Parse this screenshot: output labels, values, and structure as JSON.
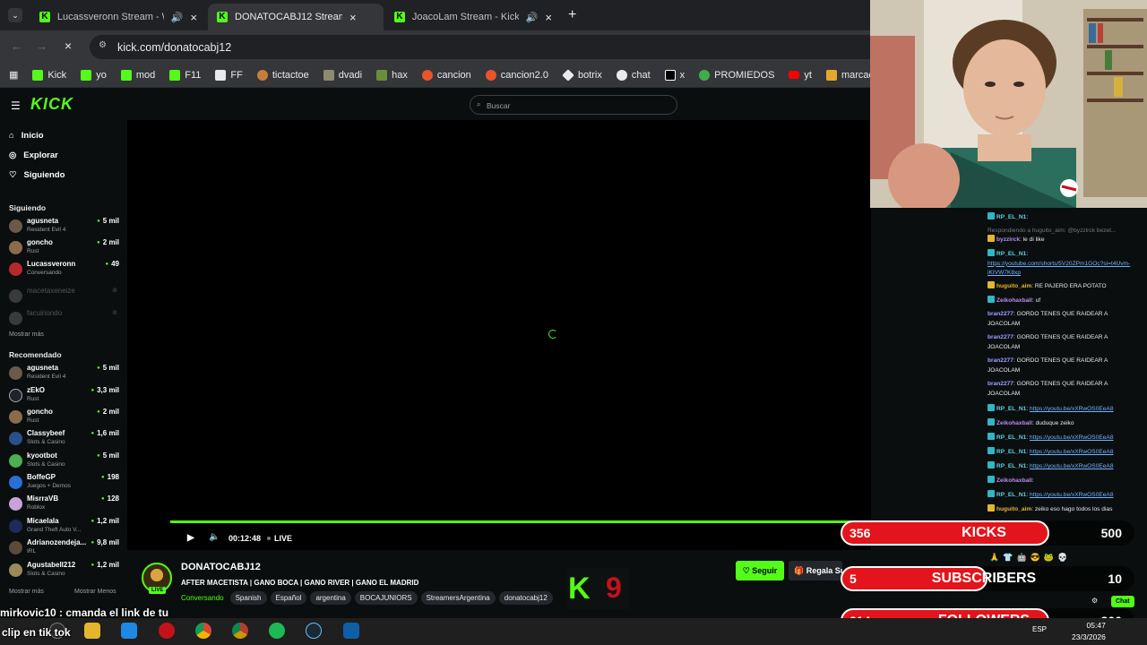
{
  "browser": {
    "tabs": [
      {
        "title": "Lucassveronn Stream - Wat"
      },
      {
        "title": "DONATOCABJ12 Stream - Watc"
      },
      {
        "title": "JoacoLam Stream - Kick Da"
      }
    ],
    "url": "kick.com/donatocabj12",
    "bookmarks": [
      "Kick",
      "yo",
      "mod",
      "F11",
      "FF",
      "tictactoe",
      "dvadi",
      "hax",
      "cancion",
      "cancion2.0",
      "botrix",
      "chat",
      "x",
      "PROMIEDOS",
      "yt",
      "marcadores"
    ]
  },
  "kick": {
    "logo": "KICK",
    "search_placeholder": "Buscar",
    "nav": {
      "home": "Inicio",
      "explore": "Explorar",
      "following": "Siguiendo"
    },
    "following_header": "Siguiendo",
    "following": [
      {
        "name": "agusneta",
        "game": "Resident Evil 4",
        "viewers": "5 mil"
      },
      {
        "name": "goncho",
        "game": "Rust",
        "viewers": "2 mil"
      },
      {
        "name": "Lucassveronn",
        "game": "Conversando",
        "viewers": "49"
      },
      {
        "name": "macetaxeneize",
        "game": "",
        "viewers": ""
      },
      {
        "name": "facuiriondo",
        "game": "",
        "viewers": ""
      }
    ],
    "show_more": "Mostrar más",
    "recommended_header": "Recomendado",
    "recommended": [
      {
        "name": "agusneta",
        "game": "Resident Evil 4",
        "viewers": "5 mil"
      },
      {
        "name": "zEkO",
        "game": "Rust",
        "viewers": "3,3 mil"
      },
      {
        "name": "goncho",
        "game": "Rust",
        "viewers": "2 mil"
      },
      {
        "name": "Classybeef",
        "game": "Slots & Casino",
        "viewers": "1,6 mil"
      },
      {
        "name": "kyootbot",
        "game": "Slots & Casino",
        "viewers": "5 mil"
      },
      {
        "name": "BoffeGP",
        "game": "Juegos + Demos",
        "viewers": "198"
      },
      {
        "name": "MisrraVB",
        "game": "Roblox",
        "viewers": "128"
      },
      {
        "name": "Micaelala",
        "game": "Grand Theft Auto V...",
        "viewers": "1,2 mil"
      },
      {
        "name": "Adrianozendeja...",
        "game": "IRL",
        "viewers": "9,8 mil"
      },
      {
        "name": "Agustabell212",
        "game": "Slots & Casino",
        "viewers": "1,2 mil"
      }
    ],
    "show_less": "Mostrar Menos",
    "player": {
      "time": "00:12:48",
      "live": "LIVE"
    },
    "stream": {
      "channel": "DONATOCABJ12",
      "title": "AFTER MACETISTA | GANO BOCA | GANO RIVER | GANO EL MADRID",
      "category": "Conversando",
      "tags": [
        "Spanish",
        "Español",
        "argentina",
        "BOCAJUNIORS",
        "StreamersArgentina",
        "donatocabj12"
      ],
      "live_badge": "LIVE",
      "follow": "Seguir",
      "gift": "Regala Sub"
    }
  },
  "chat": {
    "messages": [
      {
        "user": "RP_EL_N1",
        "text": "",
        "badge": "c"
      },
      {
        "user": "",
        "text": "Respondiendo a huguito_aim: @byzzirck bezet...",
        "badge": ""
      },
      {
        "user": "byzzirck",
        "text": "le di like",
        "badge": "y"
      },
      {
        "user": "RP_EL_N1",
        "text": "",
        "link": "https://youtube.com/shorts/5V20ZPm1GOc?si=t4Uvm-iKIVW7K8xp",
        "badge": "c"
      },
      {
        "user": "huguito_aim",
        "text": "RE PAJERO ERA POTATO",
        "badge": "y"
      },
      {
        "user": "Zeikohaxball",
        "text": "uf",
        "badge": "c"
      },
      {
        "user": "bran2277",
        "text": "GORDO TENES QUE RAIDEAR A JOACOLAM",
        "badge": ""
      },
      {
        "user": "bran2277",
        "text": "GORDO TENES QUE RAIDEAR A JOACOLAM",
        "badge": ""
      },
      {
        "user": "bran2277",
        "text": "GORDO TENES QUE RAIDEAR A JOACOLAM",
        "badge": ""
      },
      {
        "user": "bran2277",
        "text": "GORDO TENES QUE RAIDEAR A JOACOLAM",
        "badge": ""
      },
      {
        "user": "RP_EL_N1",
        "text": "",
        "link": "https://youtu.be/xXRwOS0EeA8",
        "badge": "c"
      },
      {
        "user": "Zeikohaxball",
        "text": "duduque zeiko",
        "badge": "c"
      },
      {
        "user": "RP_EL_N1",
        "text": "",
        "link": "https://youtu.be/xXRwOS0EeA8",
        "badge": "c"
      },
      {
        "user": "RP_EL_N1",
        "text": "",
        "link": "https://youtu.be/xXRwOS0EeA8",
        "badge": "c"
      },
      {
        "user": "RP_EL_N1",
        "text": "",
        "link": "https://youtu.be/xXRwOS0EeA8",
        "badge": "c"
      },
      {
        "user": "Zeikohaxball",
        "text": "",
        "badge": "c"
      },
      {
        "user": "RP_EL_N1",
        "text": "",
        "link": "https://youtu.be/xXRwOS0EeA8",
        "badge": "c"
      },
      {
        "user": "huguito_aim",
        "text": "zeiko eso hago todos los dias",
        "badge": "y"
      }
    ],
    "chat_button": "Chat"
  },
  "overlay": {
    "kicks": {
      "count": "356",
      "label": "KICKS",
      "goal": "500",
      "progress": 0.71
    },
    "subs": {
      "count": "5",
      "label": "SUBSCRIBERS",
      "goal": "10",
      "progress": 0.5
    },
    "followers": {
      "count": "214",
      "label": "FOLLOWERS",
      "goal": "300",
      "progress": 0.71
    },
    "kbox_digit": "9",
    "alert_text": "mirkovic10 : cmanda el link de tu",
    "alert_text2": "clip en tik tok"
  },
  "taskbar": {
    "time": "05:47",
    "date": "23/3/2026",
    "lang": "ESP"
  },
  "colors": {
    "kick_green": "#53fc18",
    "goal_red": "#e3141b"
  }
}
